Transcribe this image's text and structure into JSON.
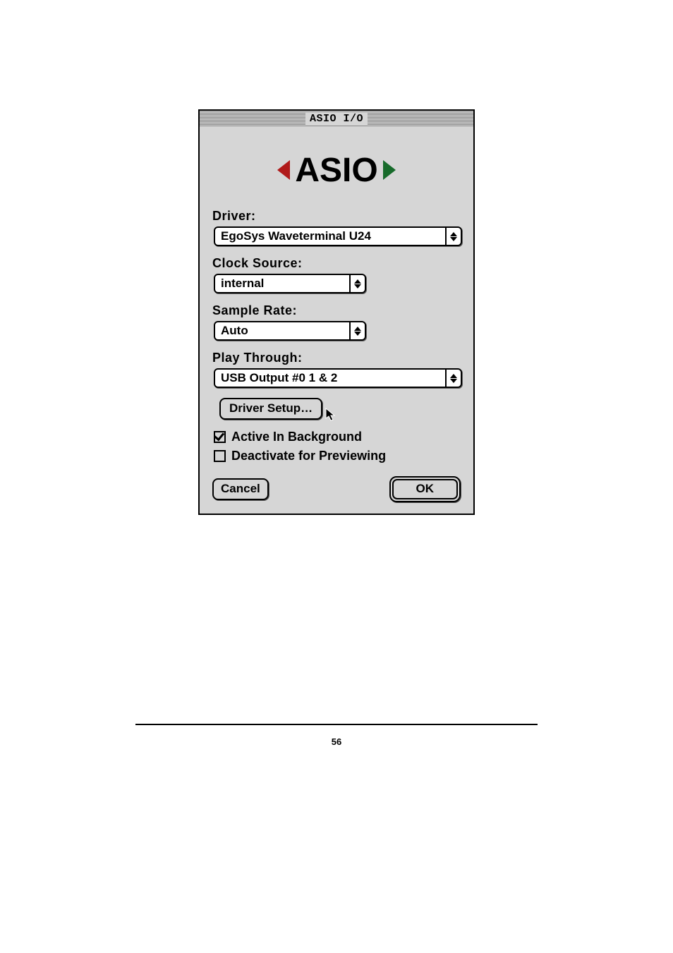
{
  "dialog": {
    "title": "ASIO I/O",
    "logo_text": "ASIO",
    "driver": {
      "label": "Driver:",
      "value": "EgoSys Waveterminal U24"
    },
    "clock_source": {
      "label": "Clock Source:",
      "value": "internal"
    },
    "sample_rate": {
      "label": "Sample Rate:",
      "value": "Auto"
    },
    "play_through": {
      "label": "Play Through:",
      "value": "USB Output #0 1 & 2"
    },
    "driver_setup_label": "Driver Setup…",
    "active_bg": {
      "checked": true,
      "label": "Active In Background"
    },
    "deactivate_preview": {
      "checked": false,
      "label": "Deactivate for Previewing"
    },
    "cancel_label": "Cancel",
    "ok_label": "OK"
  },
  "page_number": "56"
}
